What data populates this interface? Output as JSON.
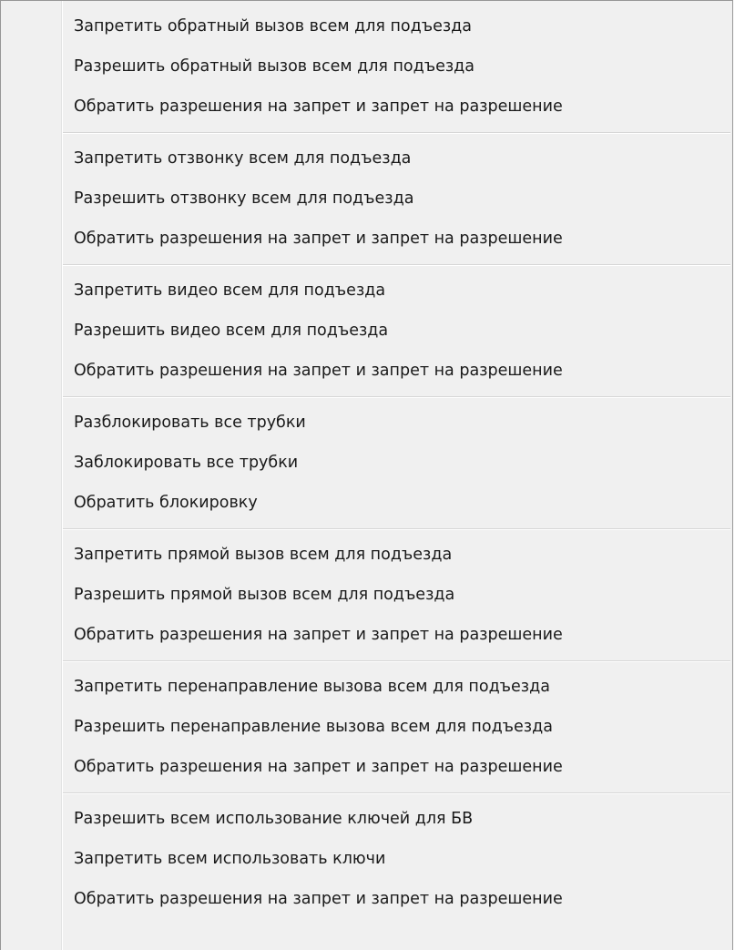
{
  "menu": {
    "groups": [
      {
        "items": [
          "Запретить обратный вызов всем для подъезда",
          "Разрешить обратный вызов всем для подъезда",
          "Обратить разрешения на запрет и запрет на разрешение"
        ]
      },
      {
        "items": [
          "Запретить отзвонку всем для подъезда",
          "Разрешить отзвонку всем для подъезда",
          "Обратить разрешения на запрет и запрет на разрешение"
        ]
      },
      {
        "items": [
          "Запретить видео всем для подъезда",
          "Разрешить видео всем для подъезда",
          "Обратить разрешения на запрет и запрет на разрешение"
        ]
      },
      {
        "items": [
          "Разблокировать все трубки",
          "Заблокировать все трубки",
          "Обратить блокировку"
        ]
      },
      {
        "items": [
          "Запретить прямой вызов всем для подъезда",
          "Разрешить прямой вызов всем для подъезда",
          "Обратить разрешения на запрет и запрет на разрешение"
        ]
      },
      {
        "items": [
          "Запретить перенаправление вызова всем для подъезда",
          "Разрешить перенаправление вызова всем для подъезда",
          "Обратить разрешения на запрет и запрет на разрешение"
        ]
      },
      {
        "items": [
          "Разрешить всем использование ключей для БВ",
          "Запретить всем использовать ключи",
          "Обратить разрешения на запрет и запрет на разрешение"
        ]
      }
    ]
  }
}
